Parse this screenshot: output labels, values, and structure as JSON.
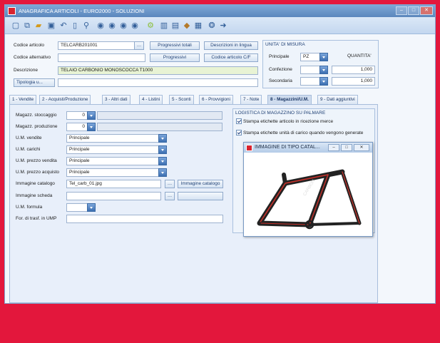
{
  "window": {
    "title": "ANAGRAFICA ARTICOLI - EURO2000 - SOLUZIONI",
    "controls": {
      "minimize": "–",
      "maximize": "□",
      "close": "✕"
    }
  },
  "toolbar": {
    "icons": [
      "new-icon",
      "copy-icon",
      "open-icon",
      "save-icon",
      "undo-icon",
      "delete-icon",
      "find-icon",
      "first-icon",
      "previous-icon",
      "next-icon",
      "last-icon",
      "settings-icon",
      "barcode-icon",
      "document-icon",
      "package-icon",
      "stock-icon",
      "help-icon",
      "exit-icon"
    ]
  },
  "header": {
    "codice_articolo_label": "Codice articolo",
    "codice_articolo_value": "TELCARB201001",
    "codice_alternativo_label": "Codice alternativo",
    "codice_alternativo_value": "",
    "descrizione_label": "Descrizione",
    "descrizione_value": "TELAIO CARBONIO MONOSCOCCA T1000",
    "tipologia_button": "Tipologia u...",
    "tipologia_value": "",
    "btn_progressivi_totali": "Progressivi totali",
    "btn_descrizioni_lingua": "Descrizioni in lingua",
    "btn_progressivi": "Progressivi",
    "btn_codice_cf": "Codice articolo C/F"
  },
  "unita_misura": {
    "title": "UNITA' DI MISURA",
    "quantita_label": "QUANTITA'",
    "principale_label": "Principale",
    "principale_value": "PZ",
    "confezione_label": "Confezione",
    "confezione_qty": "1,000",
    "secondaria_label": "Secondaria",
    "secondaria_qty": "1,000"
  },
  "tabs": [
    {
      "label": "1 - Vendite",
      "active": false
    },
    {
      "label": "2 - Acquisti/Produzione",
      "active": false
    },
    {
      "label": "3 - Altri dati",
      "active": false
    },
    {
      "label": "4 - Listini",
      "active": false
    },
    {
      "label": "5 - Sconti",
      "active": false
    },
    {
      "label": "6 - Provvigioni",
      "active": false
    },
    {
      "label": "7 - Note",
      "active": false
    },
    {
      "label": "8 - Magazzini/U.M.",
      "active": true
    },
    {
      "label": "9 - Dati aggiuntivi",
      "active": false
    }
  ],
  "magazzini": {
    "stoccaggio_label": "Magazz. stoccaggio",
    "stoccaggio_value": "0",
    "produzione_label": "Magazz. produzione",
    "produzione_value": "0",
    "um_vendite_label": "U.M. vendite",
    "um_vendite_value": "Principale",
    "um_carichi_label": "U.M. carichi",
    "um_carichi_value": "Principale",
    "um_prezzo_vendita_label": "U.M. prezzo vendita",
    "um_prezzo_vendita_value": "Principale",
    "um_prezzo_acquisto_label": "U.M. prezzo acquisto",
    "um_prezzo_acquisto_value": "Principale",
    "immagine_catalogo_label": "Immagine catalogo",
    "immagine_catalogo_value": "Tel_carb_01.jpg",
    "immagine_catalogo_button": "Immagine catalogo",
    "immagine_scheda_label": "Immagine scheda",
    "immagine_scheda_value": "",
    "um_formula_label": "U.M. formula",
    "um_formula_value": "",
    "for_trasf_label": "For. di trasf. in UMP",
    "for_trasf_value": ""
  },
  "logistica": {
    "title": "LOGISTICA DI MAGAZZINO SU PALMARE",
    "check1_label": "Stampa etichette articolo in ricezione merce",
    "check1_checked": true,
    "check2_label": "Stampa etichette unità di carico quando vengono generate",
    "check2_checked": true
  },
  "popup": {
    "title": "IMMAGINE DI TIPO CATAL...",
    "image": "bicycle-frame-image"
  },
  "colors": {
    "background": "#e3173c",
    "window_frame": "#b9d2ee",
    "title_bar": "#5b87bd",
    "dropdown_accent": "#3c6fb1",
    "frame_red": "#c8312a"
  }
}
